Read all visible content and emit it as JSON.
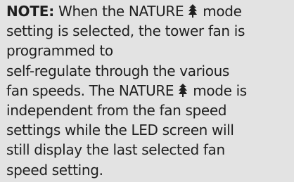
{
  "note": {
    "label": "NOTE:",
    "icon": "tree-icon",
    "lines": [
      {
        "before": " When the NATURE",
        "after": " mode"
      },
      {
        "text": "setting is selected, the tower fan is"
      },
      {
        "text": "programmed to"
      },
      {
        "text": "self-regulate through the various"
      },
      {
        "before": "fan speeds. The NATURE",
        "after": " mode is"
      },
      {
        "text": "independent from the fan speed"
      },
      {
        "text": "settings while the LED screen will"
      },
      {
        "text": "still display the last selected fan"
      },
      {
        "text": "speed setting."
      }
    ]
  }
}
